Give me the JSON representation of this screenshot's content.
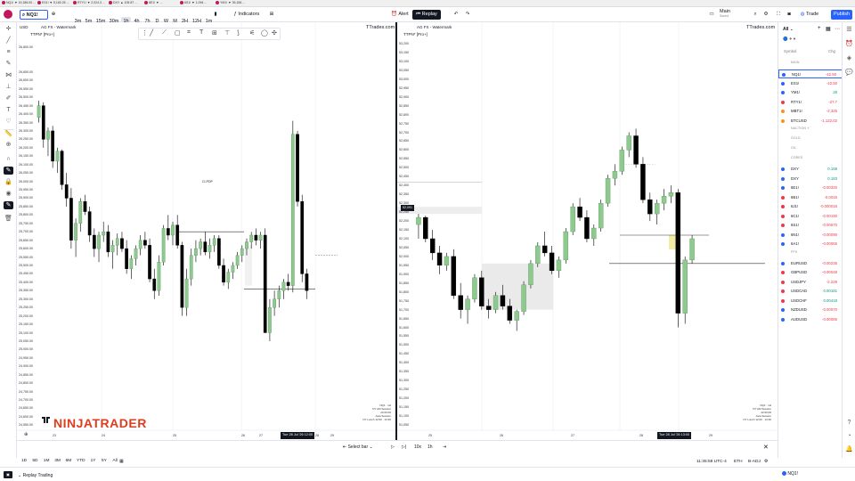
{
  "browser_tabs": [
    "NQ1! ▼ 19,186.00 ...",
    "ES1! ▼ 5,160.25 ...",
    "RTY1! ▼ 2,024.3 ...",
    "DXY ▲ 105.87 ...",
    "6E1! ▼ ...",
    "6S1! ▼ 1.094 ...",
    "YM1! ▼ 39,156 ..."
  ],
  "toolbar": {
    "symbol": "NQ1!",
    "timeframes": [
      "3m",
      "5m",
      "15m",
      "30m",
      "1h",
      "4h",
      "7h",
      "D",
      "W",
      "M",
      "2H",
      "12H",
      "1m"
    ],
    "active_timeframe": "1h",
    "indicators": "Indicators",
    "alert": "Alert",
    "replay": "Replay",
    "layout_name": "Main",
    "layout_sub": "Saved",
    "trade": "Trade",
    "publish": "Publish"
  },
  "left_chart": {
    "currency": "USD",
    "legend": "AG FX - Watermark",
    "legend2": "TTPN* [Pro+]",
    "watermark": "TTrades.com",
    "brand": "NINJATRADER",
    "prices": [
      "26,800.00",
      "26,650.00",
      "26,600.00",
      "26,550.00",
      "26,500.00",
      "26,450.00",
      "26,400.00",
      "26,350.00",
      "26,300.00",
      "26,250.00",
      "26,200.00",
      "26,150.00",
      "26,100.00",
      "26,050.00",
      "26,000.00",
      "25,950.00",
      "25,900.00",
      "25,850.00",
      "25,800.00",
      "25,750.00",
      "25,700.00",
      "25,650.00",
      "25,600.00",
      "25,550.00",
      "25,500.00",
      "25,450.00",
      "25,400.00",
      "25,350.00",
      "25,300.00",
      "25,250.00",
      "25,200.00",
      "25,150.00",
      "25,100.00",
      "25,050.00",
      "25,000.00",
      "24,950.00",
      "24,900.00",
      "24,850.00",
      "24,800.00",
      "24,750.00",
      "24,700.00",
      "24,650.00",
      "24,600.00",
      "24,550.00"
    ],
    "time_labels": [
      "23",
      "24",
      "25",
      "26",
      "27",
      "28",
      "29"
    ],
    "cursor_time": "Tue 28 Jul '26  12:00",
    "session_info": [
      "NQ1 · 1H",
      "NY AM Session",
      "22:00:00",
      "Asia Session",
      "NY Lunch 12:00 · 13:30"
    ],
    "pd_label": "CI-PDP"
  },
  "right_chart": {
    "legend": "AG FX - Watermark",
    "legend2": "TTPN* [Pro+]",
    "watermark": "TTrades.com",
    "current_price": "52,091",
    "prices": [
      "53,200",
      "53,150",
      "53,100",
      "53,050",
      "53,000",
      "52,950",
      "52,900",
      "52,850",
      "52,800",
      "52,750",
      "52,700",
      "52,650",
      "52,600",
      "52,550",
      "52,500",
      "52,450",
      "52,400",
      "52,350",
      "52,300",
      "52,250",
      "52,200",
      "52,150",
      "52,100",
      "52,050",
      "52,000",
      "51,950",
      "51,900",
      "51,850",
      "51,800",
      "51,750",
      "51,700",
      "51,650",
      "51,600",
      "51,550",
      "51,500",
      "51,450",
      "51,400",
      "51,350",
      "51,300",
      "51,250",
      "51,200",
      "51,150",
      "51,100",
      "51,050"
    ],
    "time_labels": [
      "25",
      "26",
      "27",
      "28",
      "29"
    ],
    "cursor_time": "Tue 28 Jul '26  13:00",
    "session_info": [
      "NQ1 · 1H",
      "NY AM Session",
      "22:00:00",
      "Asia Session",
      "NY Lunch 12:00 · 13:30"
    ]
  },
  "bottom": {
    "periods": [
      "1D",
      "5D",
      "1M",
      "3M",
      "6M",
      "YTD",
      "1Y",
      "5Y",
      "All"
    ],
    "select_bar": "Select bar",
    "speed": "10x",
    "interval": "1h",
    "clock": "11:35:59 UTC-4",
    "session": "ETH",
    "adj": "B-ADJ"
  },
  "replay": {
    "label": "Replay Trading"
  },
  "watchlist": {
    "title": "All",
    "col_symbol": "Symbol",
    "col_chg": "Chg",
    "sections": [
      {
        "name": "MAIN",
        "items": [
          {
            "sym": "NQ1!",
            "chg": "-42.50",
            "color": "#f23645",
            "dot": "#2962ff",
            "selected": true
          },
          {
            "sym": "ES1!",
            "chg": "-10.50",
            "color": "#f23645",
            "dot": "#2962ff"
          },
          {
            "sym": "YM1!",
            "chg": "28",
            "color": "#089981",
            "dot": "#2962ff"
          },
          {
            "sym": "RTY1!",
            "chg": "-27.7",
            "color": "#f23645",
            "dot": "#f23645"
          },
          {
            "sym": "MBT1!",
            "chg": "-2,325",
            "color": "#f23645",
            "dot": "#f7931a"
          },
          {
            "sym": "BTCUSD",
            "chg": "-1,122.02",
            "color": "#f23645",
            "dot": "#f7931a"
          }
        ]
      },
      {
        "name": "NACTION Y",
        "items": []
      },
      {
        "name": "GOLD",
        "items": []
      },
      {
        "name": "OIL",
        "items": []
      },
      {
        "name": "CORES",
        "items": [
          {
            "sym": "DXY",
            "chg": "0.158",
            "color": "#089981",
            "dot": "#2962ff"
          },
          {
            "sym": "DXY",
            "chg": "0.183",
            "color": "#089981",
            "dot": "#2962ff"
          },
          {
            "sym": "6E1!",
            "chg": "-0.00320",
            "color": "#f23645",
            "dot": "#2962ff"
          },
          {
            "sym": "6B1!",
            "chg": "-0.0015",
            "color": "#f23645",
            "dot": "#f23645"
          },
          {
            "sym": "6J1!",
            "chg": "-0.000016",
            "color": "#f23645",
            "dot": "#f23645"
          },
          {
            "sym": "6C1!",
            "chg": "-0.00190",
            "color": "#f23645",
            "dot": "#f23645"
          },
          {
            "sym": "6S1!",
            "chg": "-0.00670",
            "color": "#f23645",
            "dot": "#f23645"
          },
          {
            "sym": "6N1!",
            "chg": "-0.00090",
            "color": "#f23645",
            "dot": "#2962ff"
          },
          {
            "sym": "6A1!",
            "chg": "-0.00065",
            "color": "#f23645",
            "dot": "#2962ff"
          }
        ]
      },
      {
        "name": "FPX",
        "items": [
          {
            "sym": "EURUSD",
            "chg": "-0.00235",
            "color": "#f23645",
            "dot": "#2962ff"
          },
          {
            "sym": "GBPUSD",
            "chg": "-0.00049",
            "color": "#f23645",
            "dot": "#f23645"
          },
          {
            "sym": "USDJPY",
            "chg": "-2.228",
            "color": "#f23645",
            "dot": "#f23645"
          },
          {
            "sym": "USDCAD",
            "chg": "0.00181",
            "color": "#089981",
            "dot": "#f23645"
          },
          {
            "sym": "USDCHF",
            "chg": "0.00419",
            "color": "#089981",
            "dot": "#f23645"
          },
          {
            "sym": "NZDUSD",
            "chg": "-0.00070",
            "color": "#f23645",
            "dot": "#2962ff"
          },
          {
            "sym": "AUDUSD",
            "chg": "-0.00085",
            "color": "#f23645",
            "dot": "#2962ff"
          }
        ]
      }
    ]
  },
  "chart_data": [
    {
      "type": "candlestick",
      "id": "left",
      "candles": [
        [
          26380,
          26480,
          26350,
          26450
        ],
        [
          26450,
          26470,
          26200,
          26250
        ],
        [
          26250,
          26320,
          26150,
          26300
        ],
        [
          26300,
          26330,
          26080,
          26120
        ],
        [
          26120,
          26200,
          26050,
          26180
        ],
        [
          26180,
          26190,
          25950,
          25980
        ],
        [
          25980,
          26050,
          25850,
          25900
        ],
        [
          25900,
          25960,
          25600,
          25650
        ],
        [
          25650,
          25780,
          25550,
          25750
        ],
        [
          25750,
          25900,
          25700,
          25880
        ],
        [
          25880,
          25920,
          25800,
          25820
        ],
        [
          25820,
          25850,
          25640,
          25680
        ],
        [
          25680,
          25720,
          25550,
          25600
        ],
        [
          25600,
          25700,
          25520,
          25680
        ],
        [
          25680,
          25760,
          25640,
          25700
        ],
        [
          25700,
          25740,
          25550,
          25580
        ],
        [
          25580,
          25650,
          25480,
          25620
        ],
        [
          25620,
          25690,
          25560,
          25660
        ],
        [
          25660,
          25700,
          25580,
          25600
        ],
        [
          25600,
          25650,
          25450,
          25480
        ],
        [
          25480,
          25560,
          25420,
          25540
        ],
        [
          25540,
          25620,
          25500,
          25600
        ],
        [
          25600,
          25680,
          25560,
          25650
        ],
        [
          25650,
          25700,
          25600,
          25620
        ],
        [
          25620,
          25660,
          25400,
          25420
        ],
        [
          25420,
          25480,
          25300,
          25350
        ],
        [
          25350,
          25560,
          25320,
          25520
        ],
        [
          25520,
          25740,
          25500,
          25720
        ],
        [
          25720,
          25800,
          25650,
          25680
        ],
        [
          25680,
          25760,
          25620,
          25740
        ],
        [
          25740,
          25800,
          25600,
          25620
        ],
        [
          25620,
          25640,
          25200,
          25250
        ],
        [
          25250,
          25480,
          25200,
          25420
        ],
        [
          25420,
          25600,
          25380,
          25560
        ],
        [
          25560,
          25650,
          25520,
          25600
        ],
        [
          25600,
          25660,
          25560,
          25640
        ],
        [
          25640,
          25700,
          25560,
          25580
        ],
        [
          25580,
          25660,
          25540,
          25620
        ],
        [
          25620,
          25680,
          25580,
          25660
        ],
        [
          25660,
          25680,
          25480,
          25500
        ],
        [
          25500,
          25540,
          25380,
          25400
        ],
        [
          25400,
          25480,
          25360,
          25460
        ],
        [
          25460,
          25520,
          25420,
          25500
        ],
        [
          25500,
          25580,
          25480,
          25560
        ],
        [
          25560,
          25620,
          25520,
          25600
        ],
        [
          25600,
          25660,
          25560,
          25640
        ],
        [
          25640,
          25700,
          25600,
          25680
        ],
        [
          25680,
          25720,
          25620,
          25650
        ],
        [
          25650,
          25700,
          25600,
          25680
        ],
        [
          25680,
          25720,
          25200,
          25100
        ],
        [
          25100,
          25300,
          25050,
          25250
        ],
        [
          25250,
          25350,
          25200,
          25300
        ],
        [
          25300,
          25380,
          25250,
          25350
        ],
        [
          25350,
          25420,
          25300,
          25400
        ],
        [
          25400,
          25450,
          25350,
          25380
        ],
        [
          25380,
          26360,
          25340,
          26280
        ],
        [
          26280,
          26300,
          25850,
          25880
        ],
        [
          25880,
          25920,
          25400,
          25450
        ],
        [
          25450,
          25480,
          25300,
          25350
        ]
      ]
    },
    {
      "type": "candlestick",
      "id": "right",
      "candles": [
        [
          52180,
          52240,
          52100,
          52220
        ],
        [
          52220,
          52230,
          52080,
          52100
        ],
        [
          52100,
          52150,
          51980,
          52020
        ],
        [
          52020,
          52060,
          51900,
          51950
        ],
        [
          51950,
          52020,
          51920,
          52000
        ],
        [
          52000,
          52040,
          51760,
          51780
        ],
        [
          51780,
          51850,
          51650,
          51700
        ],
        [
          51700,
          51780,
          51620,
          51760
        ],
        [
          51760,
          51900,
          51740,
          51880
        ],
        [
          51880,
          51920,
          51700,
          51720
        ],
        [
          51720,
          51760,
          51650,
          51700
        ],
        [
          51700,
          51800,
          51680,
          51780
        ],
        [
          51780,
          51840,
          51700,
          51720
        ],
        [
          51720,
          51760,
          51620,
          51640
        ],
        [
          51640,
          51700,
          51580,
          51690
        ],
        [
          51690,
          51860,
          51670,
          51840
        ],
        [
          51840,
          51980,
          51820,
          51960
        ],
        [
          51960,
          52080,
          51940,
          52060
        ],
        [
          52060,
          52140,
          52000,
          52020
        ],
        [
          52020,
          52060,
          51900,
          51920
        ],
        [
          51920,
          52000,
          51880,
          51980
        ],
        [
          51980,
          52160,
          51960,
          52140
        ],
        [
          52140,
          52300,
          52120,
          52280
        ],
        [
          52280,
          52330,
          52200,
          52220
        ],
        [
          52220,
          52260,
          52080,
          52100
        ],
        [
          52100,
          52180,
          52060,
          52160
        ],
        [
          52160,
          52320,
          52140,
          52300
        ],
        [
          52300,
          52460,
          52280,
          52440
        ],
        [
          52440,
          52520,
          52400,
          52480
        ],
        [
          52480,
          52620,
          52460,
          52600
        ],
        [
          52600,
          52700,
          52560,
          52680
        ],
        [
          52680,
          52720,
          52500,
          52520
        ],
        [
          52520,
          52560,
          52300,
          52320
        ],
        [
          52320,
          52360,
          52200,
          52240
        ],
        [
          52240,
          52320,
          52180,
          52300
        ],
        [
          52300,
          52380,
          52260,
          52340
        ],
        [
          52340,
          52400,
          52300,
          52360
        ],
        [
          52360,
          52380,
          51600,
          51680
        ],
        [
          51680,
          52000,
          51620,
          51980
        ],
        [
          51980,
          52120,
          51960,
          52100
        ]
      ]
    }
  ]
}
